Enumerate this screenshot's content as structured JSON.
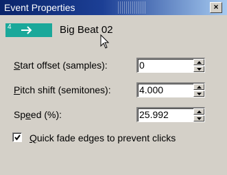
{
  "window": {
    "title": "Event Properties",
    "close_label": "×"
  },
  "event": {
    "number": "4",
    "name": "Big Beat 02",
    "badge_color": "#1aa89a"
  },
  "fields": [
    {
      "label_underlined": "S",
      "label_rest": "tart offset (samples):",
      "value": "0"
    },
    {
      "label_underlined": "P",
      "label_rest": "itch shift (semitones):",
      "value": "4.000"
    },
    {
      "label_pre": "Sp",
      "label_underlined": "e",
      "label_rest": "ed (%):",
      "value": "25.992"
    }
  ],
  "checkbox": {
    "checked": true,
    "label_underlined": "Q",
    "label_rest": "uick fade edges to prevent clicks"
  },
  "icons": {
    "badge_arrow": "return-arrow-icon",
    "cursor": "mouse-pointer-icon",
    "spin_up": "arrow-up-icon",
    "spin_down": "arrow-down-icon",
    "check": "checkmark-icon"
  }
}
